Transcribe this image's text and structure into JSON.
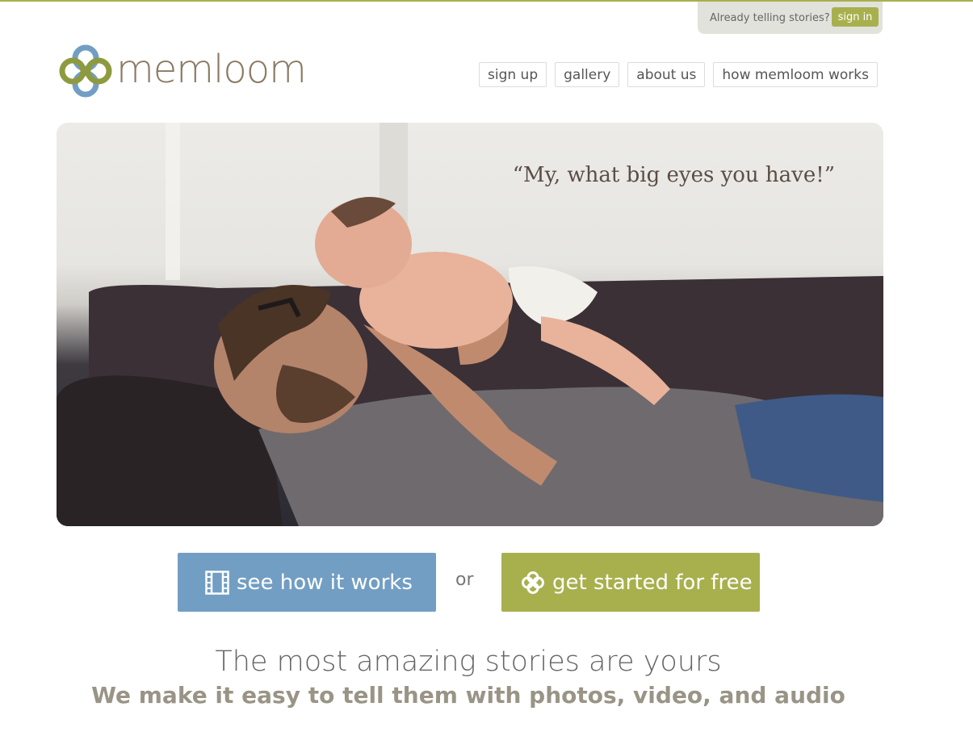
{
  "header": {
    "signin_prompt": "Already telling stories?",
    "signin_label": "sign in",
    "logo_text": "memloom"
  },
  "nav": {
    "items": [
      {
        "label": "sign up"
      },
      {
        "label": "gallery"
      },
      {
        "label": "about us"
      },
      {
        "label": "how memloom works"
      }
    ]
  },
  "hero": {
    "quote": "“My, what big eyes you have!”"
  },
  "cta": {
    "how_label": "see how it works",
    "or_label": "or",
    "free_label": "get started for free"
  },
  "footer": {
    "tagline": "The most amazing stories are yours",
    "subline": "We make it easy to tell them with photos, video, and audio"
  },
  "colors": {
    "accent_green": "#a8b04e",
    "accent_blue": "#729ec3",
    "logo_brown": "#8a7963"
  },
  "icons": {
    "logo_mark": "quatrefoil-knot-icon",
    "how_icon": "film-strip-icon",
    "free_icon": "quatrefoil-icon"
  }
}
